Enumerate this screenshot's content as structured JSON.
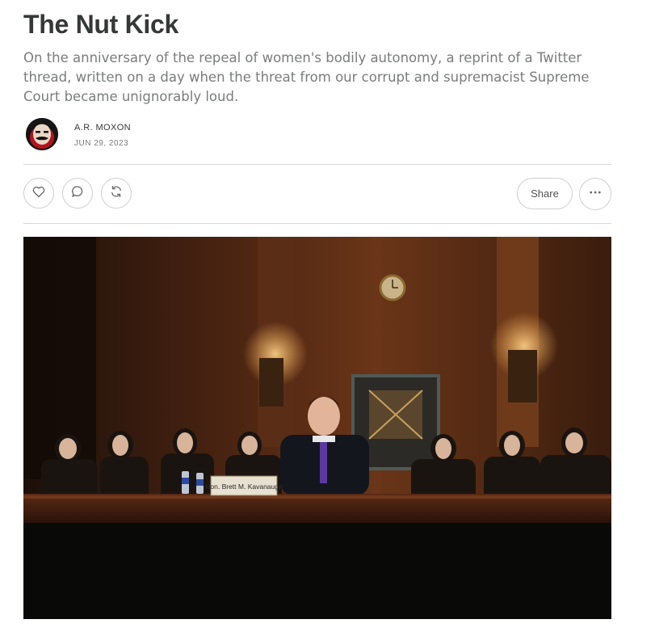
{
  "post": {
    "title": "The Nut Kick",
    "subtitle": "On the anniversary of the repeal of women's bodily autonomy, a reprint of a Twitter thread, written on a day when the threat from our corrupt and supremacist Supreme Court became unignorably loud.",
    "author": "A.R. MOXON",
    "date": "JUN 29, 2023"
  },
  "actions": {
    "like_icon": "heart-icon",
    "comment_icon": "comment-icon",
    "restack_icon": "restack-icon",
    "share_label": "Share",
    "more_icon": "ellipsis-icon"
  },
  "hero_image": {
    "nameplate": "Hon. Brett M. Kavanaugh"
  },
  "colors": {
    "text": "#363737",
    "muted": "#7b7c7c",
    "divider": "#d8d8d8"
  }
}
